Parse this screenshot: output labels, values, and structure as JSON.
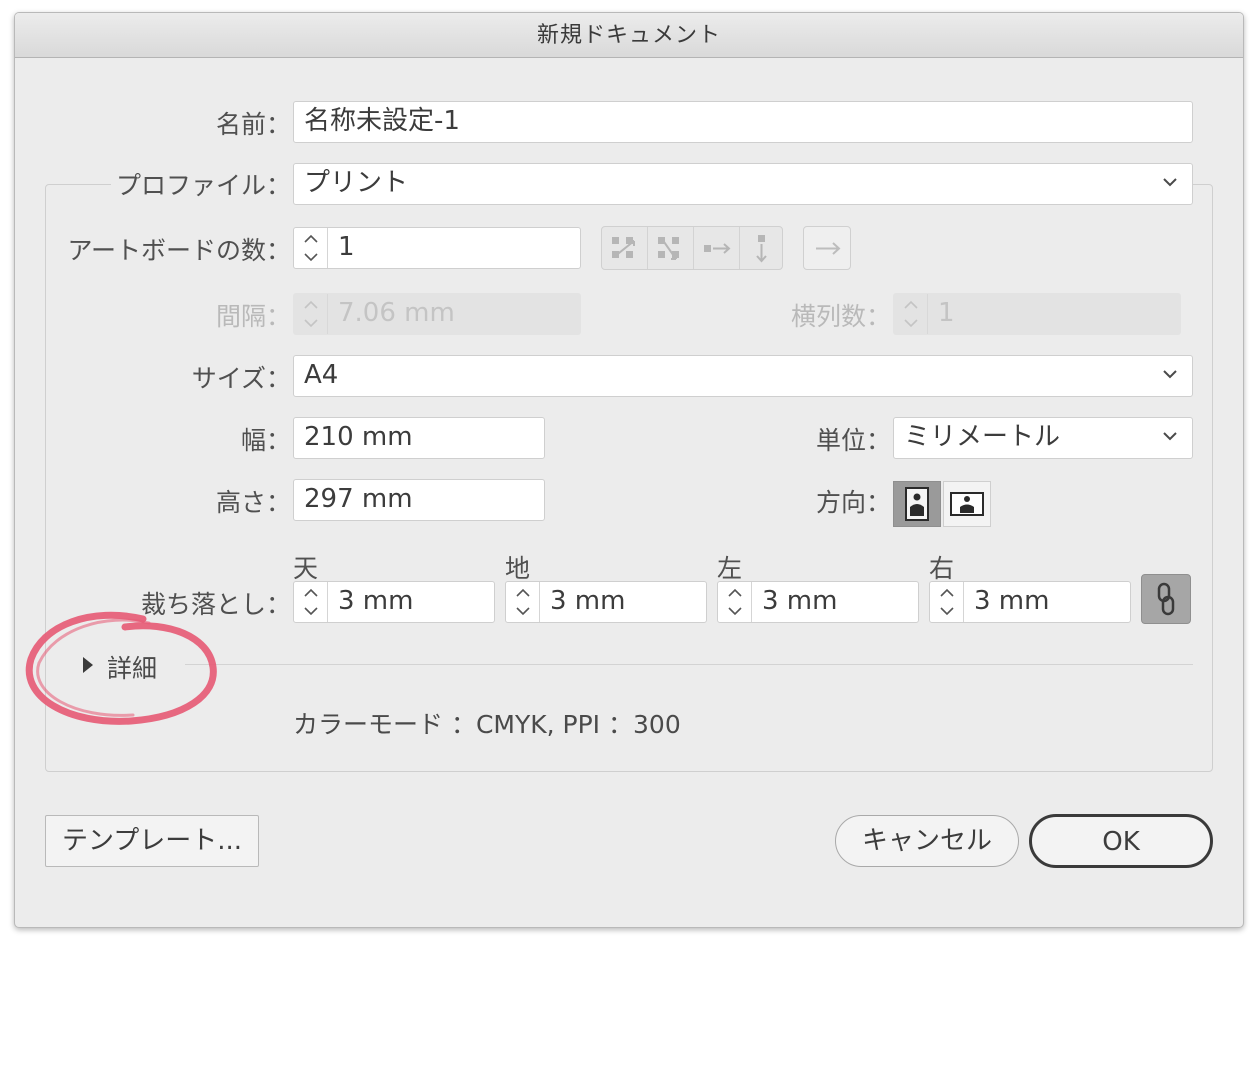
{
  "dialog": {
    "title": "新規ドキュメント",
    "name": {
      "label": "名前：",
      "value": "名称未設定-1"
    },
    "profile": {
      "label": "プロファイル：",
      "value": "プリント"
    },
    "artboards": {
      "label": "アートボードの数：",
      "value": "1",
      "arrange_icons": [
        "grid-by-row-icon",
        "grid-by-column-icon",
        "arrange-by-row-icon",
        "arrange-by-column-icon"
      ],
      "direction_icon": "right-to-left-arrow-icon"
    },
    "spacing": {
      "label": "間隔：",
      "value": "7.06 mm",
      "disabled": true
    },
    "columns": {
      "label": "横列数：",
      "value": "1",
      "disabled": true
    },
    "size": {
      "label": "サイズ：",
      "value": "A4"
    },
    "width": {
      "label": "幅：",
      "value": "210 mm"
    },
    "units": {
      "label": "単位：",
      "value": "ミリメートル"
    },
    "height": {
      "label": "高さ：",
      "value": "297 mm"
    },
    "orientation": {
      "label": "方向：",
      "selected": "portrait"
    },
    "bleed": {
      "label": "裁ち落とし：",
      "top": {
        "label": "天",
        "value": "3 mm"
      },
      "bottom": {
        "label": "地",
        "value": "3 mm"
      },
      "left": {
        "label": "左",
        "value": "3 mm"
      },
      "right": {
        "label": "右",
        "value": "3 mm"
      },
      "link_icon": "chain-link-icon"
    },
    "advanced": {
      "label": "詳細",
      "expanded": false
    },
    "info": {
      "color_mode": "カラーモード ：CMYK, PPI ：300"
    },
    "buttons": {
      "templates": "テンプレート...",
      "cancel": "キャンセル",
      "ok": "OK"
    }
  },
  "annotation": {
    "color": "#e75a74"
  }
}
